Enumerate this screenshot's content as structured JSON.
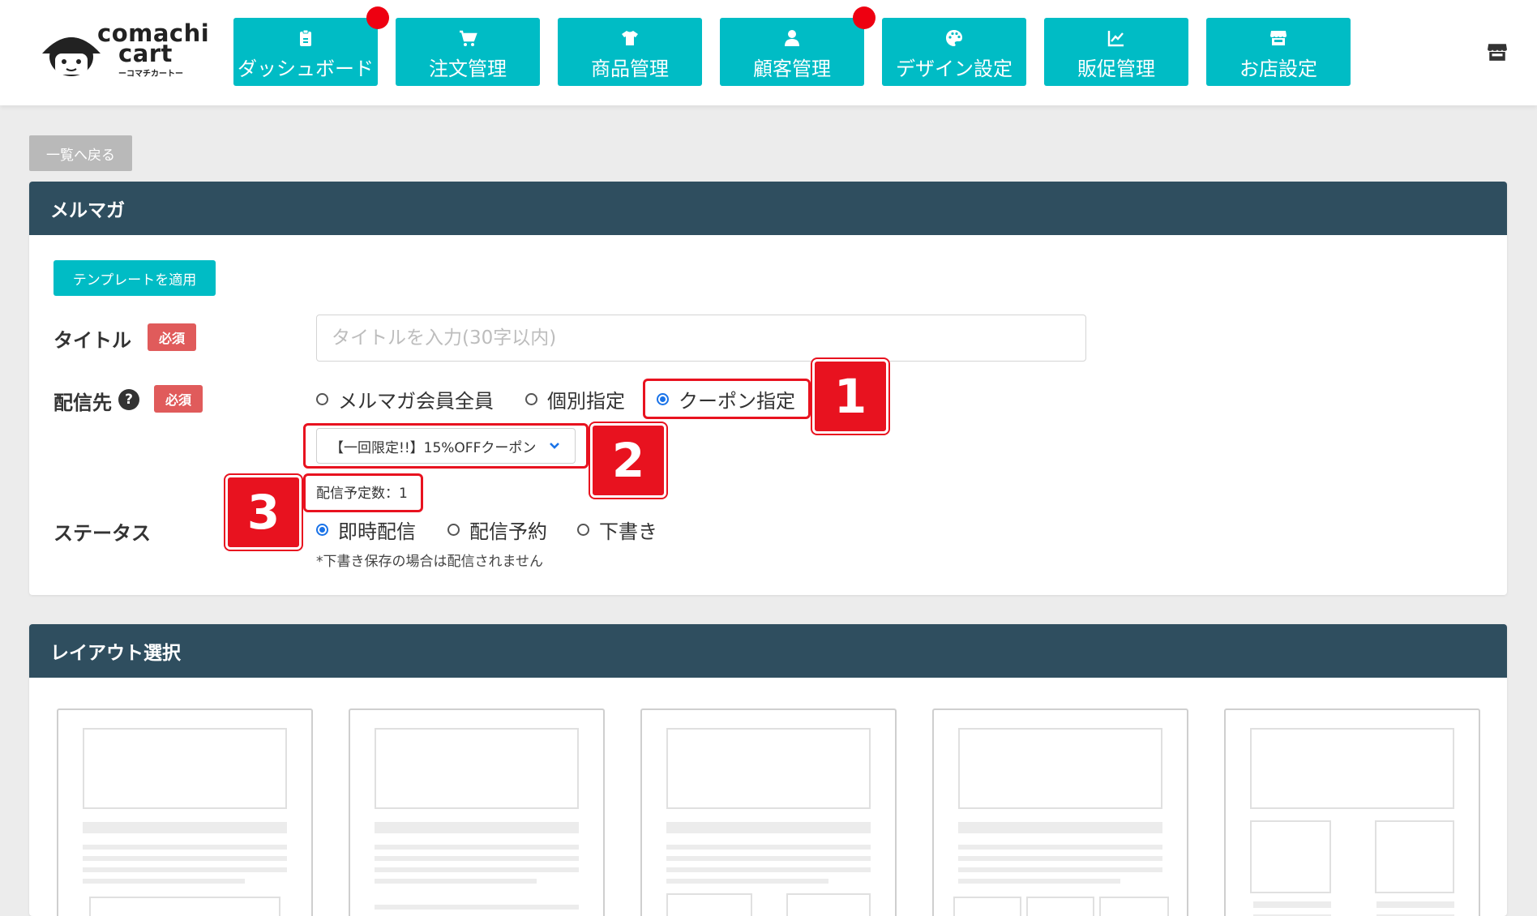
{
  "header": {
    "logo": {
      "line1": "comachi",
      "line2": "cart",
      "sub": "ーコマチカートー"
    },
    "nav": [
      {
        "label": "ダッシュボード",
        "icon": "clipboard-icon",
        "notify": true
      },
      {
        "label": "注文管理",
        "icon": "cart-icon",
        "notify": false
      },
      {
        "label": "商品管理",
        "icon": "tshirt-icon",
        "notify": false
      },
      {
        "label": "顧客管理",
        "icon": "user-icon",
        "notify": true
      },
      {
        "label": "デザイン設定",
        "icon": "palette-icon",
        "notify": false
      },
      {
        "label": "販促管理",
        "icon": "chart-line-icon",
        "notify": false
      },
      {
        "label": "お店設定",
        "icon": "store-icon",
        "notify": false
      }
    ],
    "store_icon": "store-icon"
  },
  "back_label": "一覧へ戻る",
  "mailmag": {
    "section_title": "メルマガ",
    "template_button": "テンプレートを適用",
    "title_label": "タイトル",
    "required_badge": "必須",
    "title_placeholder": "タイトルを入力(30字以内)",
    "title_value": "",
    "dest_label": "配信先",
    "help_icon": "?",
    "dest_options": [
      {
        "label": "メルマガ会員全員",
        "checked": false
      },
      {
        "label": "個別指定",
        "checked": false
      },
      {
        "label": "クーポン指定",
        "checked": true
      }
    ],
    "coupon_select": "【一回限定!!】15%OFFクーポン",
    "scheduled_count": "配信予定数：1",
    "status_label": "ステータス",
    "status_options": [
      {
        "label": "即時配信",
        "checked": true
      },
      {
        "label": "配信予約",
        "checked": false
      },
      {
        "label": "下書き",
        "checked": false
      }
    ],
    "draft_note": "*下書き保存の場合は配信されません"
  },
  "annotations": {
    "a1": "1",
    "a2": "2",
    "a3": "3"
  },
  "layout": {
    "section_title": "レイアウト選択",
    "thumbnails": [
      "layout-1",
      "layout-2",
      "layout-3",
      "layout-4",
      "layout-5"
    ]
  },
  "colors": {
    "accent": "#00bcc5",
    "section_header": "#2f4e5f",
    "required": "#e05b5b",
    "notify_dot": "#ee0011",
    "annotation": "#e8121f"
  }
}
